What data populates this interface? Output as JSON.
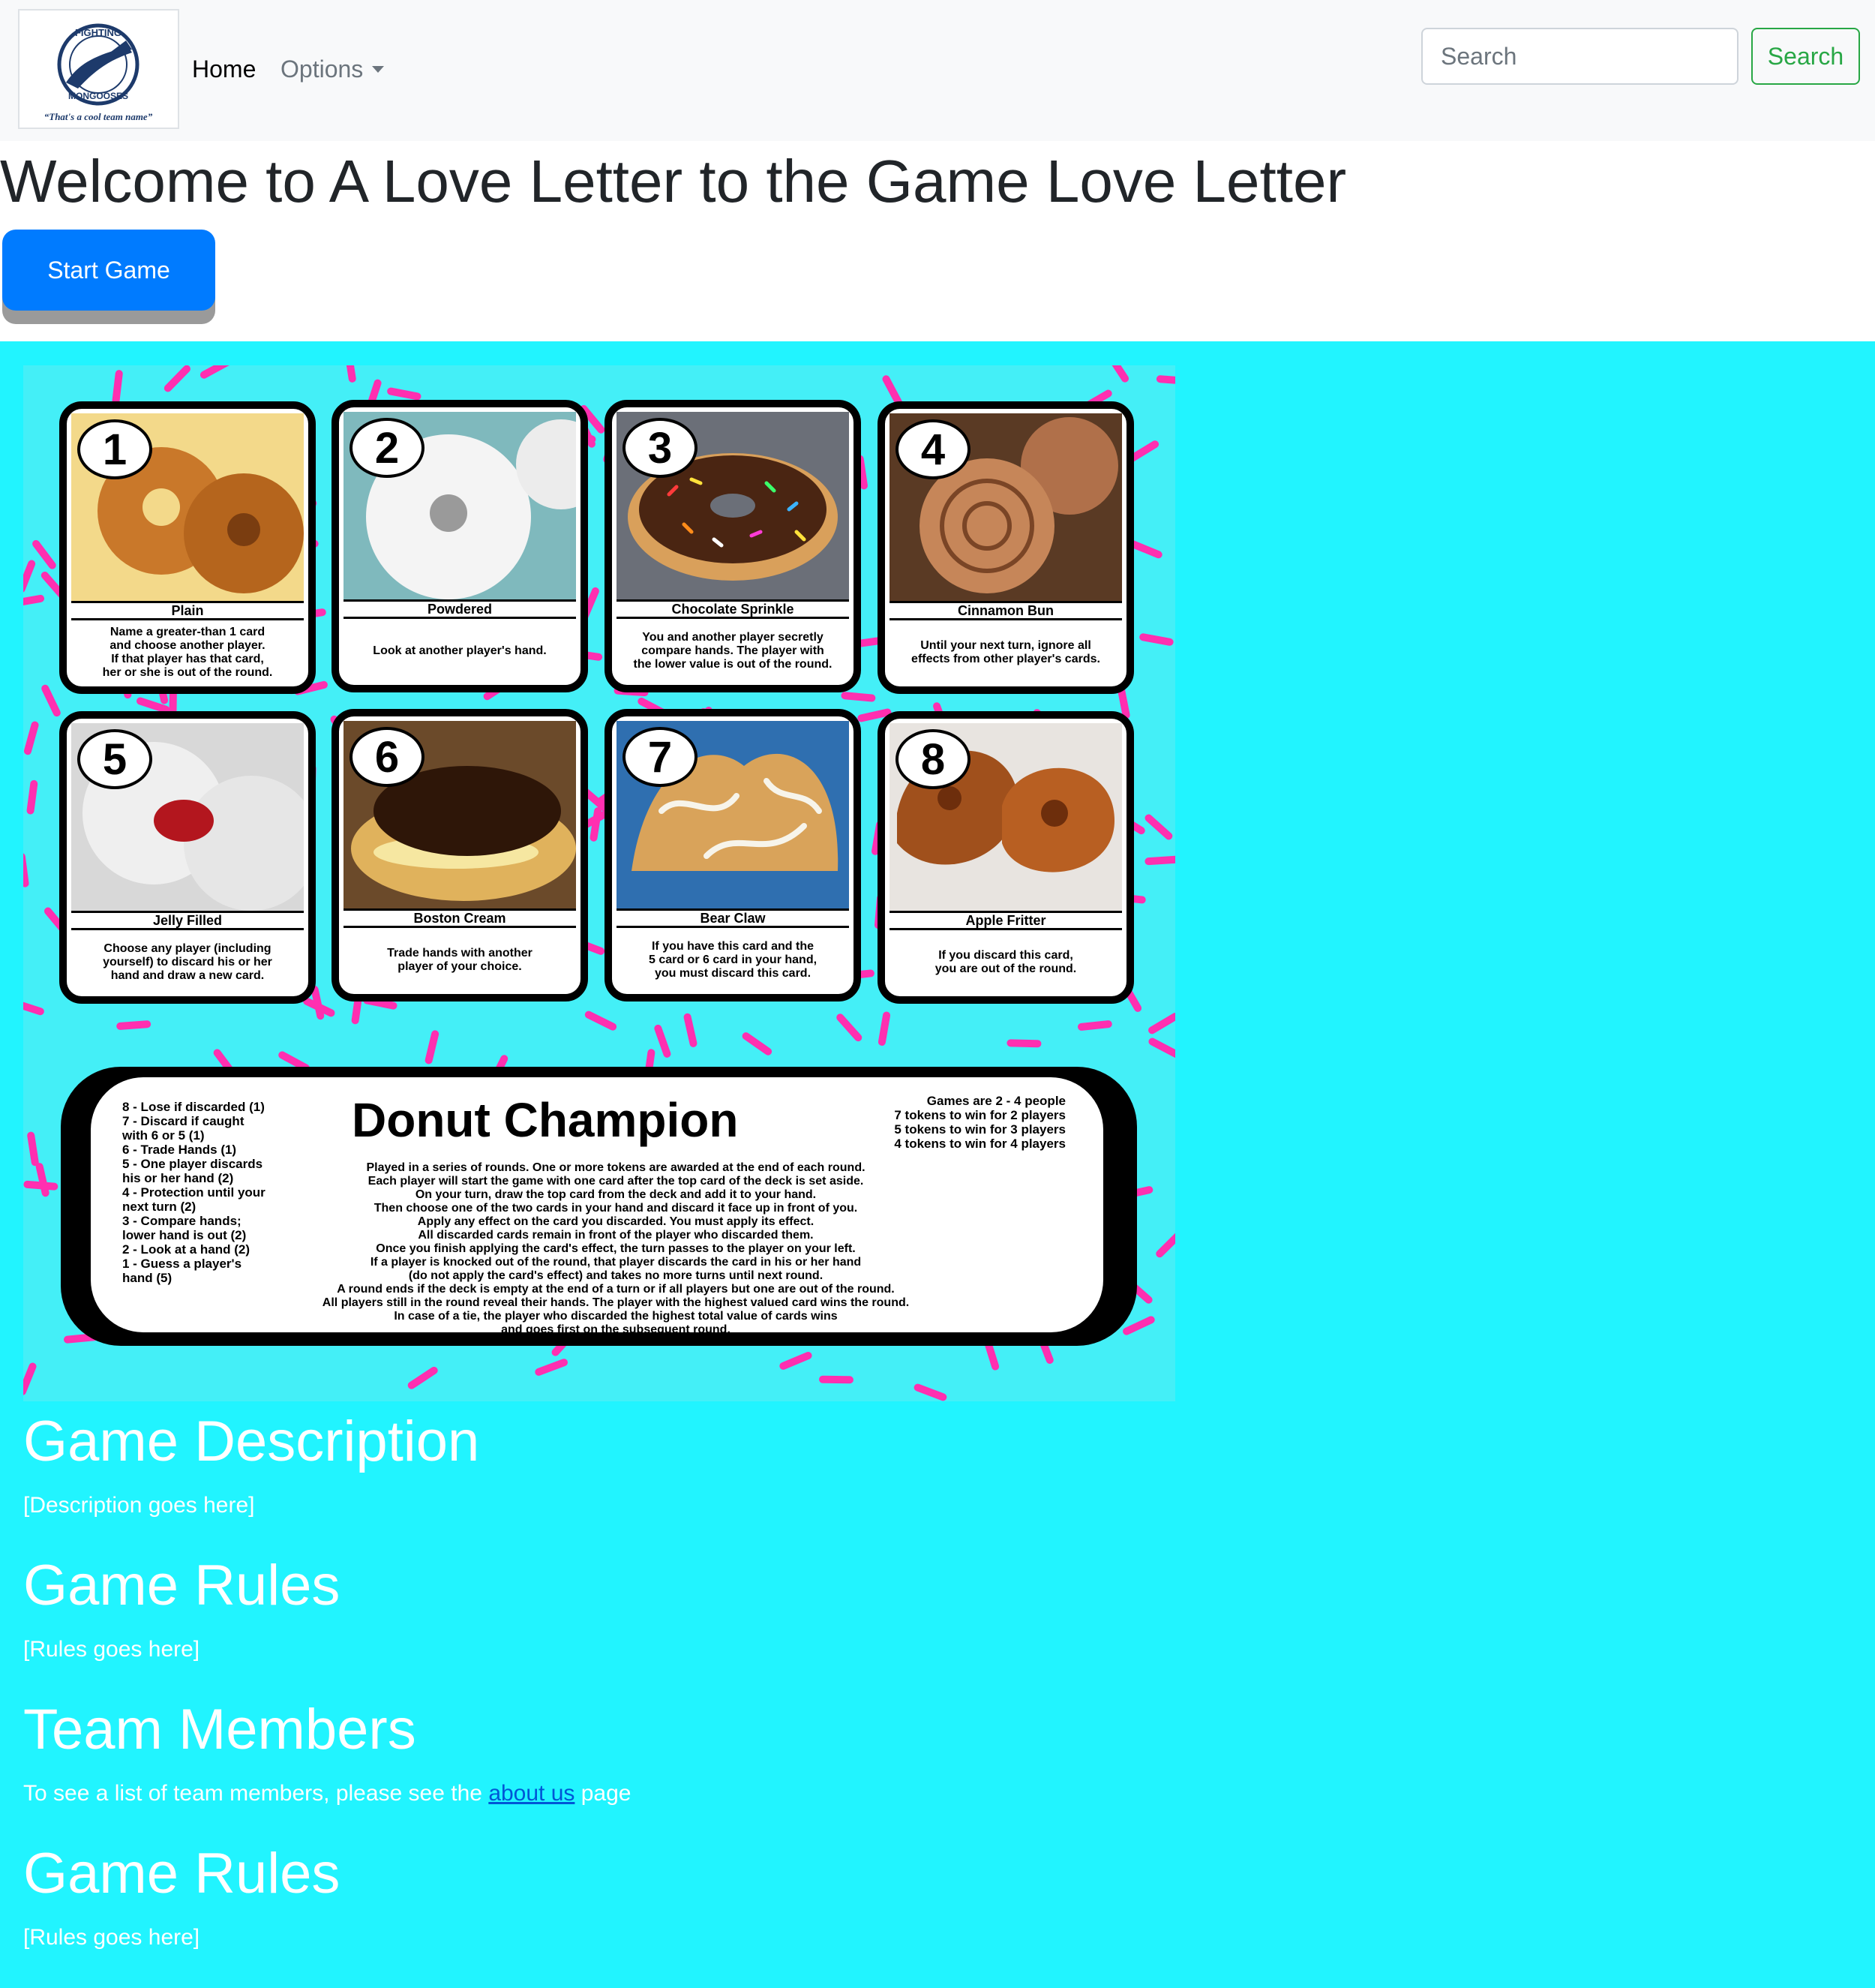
{
  "navbar": {
    "logo_text_top": "FIGHTING",
    "logo_text_bottom": "MONGOOSES",
    "logo_tagline": "“That's a cool team name”",
    "home_label": "Home",
    "options_label": "Options",
    "search_placeholder": "Search",
    "search_button": "Search"
  },
  "header": {
    "title": "Welcome to A Love Letter to the Game Love Letter",
    "start_button": "Start Game"
  },
  "board": {
    "cards": [
      {
        "num": "1",
        "name": "Plain",
        "text": "Name a greater-than 1 card\nand choose another player.\nIf that player has that card,\nher or she is out of the round."
      },
      {
        "num": "2",
        "name": "Powdered",
        "text": "Look at another player's hand."
      },
      {
        "num": "3",
        "name": "Chocolate Sprinkle",
        "text": "You and another player secretly\ncompare hands. The player with\nthe lower value is out of the round."
      },
      {
        "num": "4",
        "name": "Cinnamon Bun",
        "text": "Until your next turn, ignore all\neffects from other player's cards."
      },
      {
        "num": "5",
        "name": "Jelly Filled",
        "text": "Choose any player (including\nyourself) to discard his or her\nhand and draw a new card."
      },
      {
        "num": "6",
        "name": "Boston Cream",
        "text": "Trade hands with another\nplayer of your choice."
      },
      {
        "num": "7",
        "name": "Bear Claw",
        "text": "If you have this card and the\n5 card or 6 card in your hand,\nyou must discard this card."
      },
      {
        "num": "8",
        "name": "Apple Fritter",
        "text": "If you discard this card,\nyou are out of the round."
      }
    ],
    "champion": {
      "title": "Donut Champion",
      "summary": "8 - Lose if discarded (1)\n7 - Discard if caught\n      with 6 or 5 (1)\n6 - Trade Hands (1)\n5 - One player discards\n      his or her hand (2)\n4 - Protection until your\n      next turn (2)\n3 - Compare hands;\n      lower hand is out (2)\n2 - Look at a hand (2)\n1 - Guess a player's\n      hand (5)",
      "players": "Games are 2 - 4 people\n7 tokens to win for 2 players\n5 tokens to win for 3 players\n4 tokens to win for 4 players",
      "rules": "Played in a series of rounds. One or more tokens are awarded at the end of each round.\nEach player will start the game with one card after the top card of the deck is set aside.\nOn your turn, draw the top card from the deck and add it to your hand.\nThen choose one of the two cards in your hand and discard it face up in front of you.\nApply any effect on the card you discarded. You must apply its effect.\nAll discarded cards remain in front of the player who discarded them.\nOnce you finish applying the card's effect, the turn passes to the player on your left.\nIf a player is knocked out of the round, that player discards the card in his or her hand\n(do not apply the card's effect) and takes no more turns until next round.\nA round ends if the deck is empty at the end of a turn or if all players but one are out of the round.\nAll players still in the round reveal their hands. The player with the highest valued card wins the round.\nIn case of a tie, the player who discarded the highest total value of cards wins\nand goes first on the subsequent round."
    }
  },
  "sections": {
    "description_heading": "Game Description",
    "description_text": "[Description goes here]",
    "rules_heading": "Game Rules",
    "rules_text": "[Rules goes here]",
    "team_heading": "Team Members",
    "team_text_before": "To see a list of team members, please see the",
    "team_link": "about us",
    "team_text_after": "page",
    "rules2_heading": "Game Rules",
    "rules2_text": "[Rules goes here]"
  },
  "colors": {
    "navbar_bg": "#f8f9fa",
    "page_bg": "#21f4ff",
    "primary": "#007bff",
    "success": "#28a745",
    "sprinkle": "#ff2fb0"
  }
}
